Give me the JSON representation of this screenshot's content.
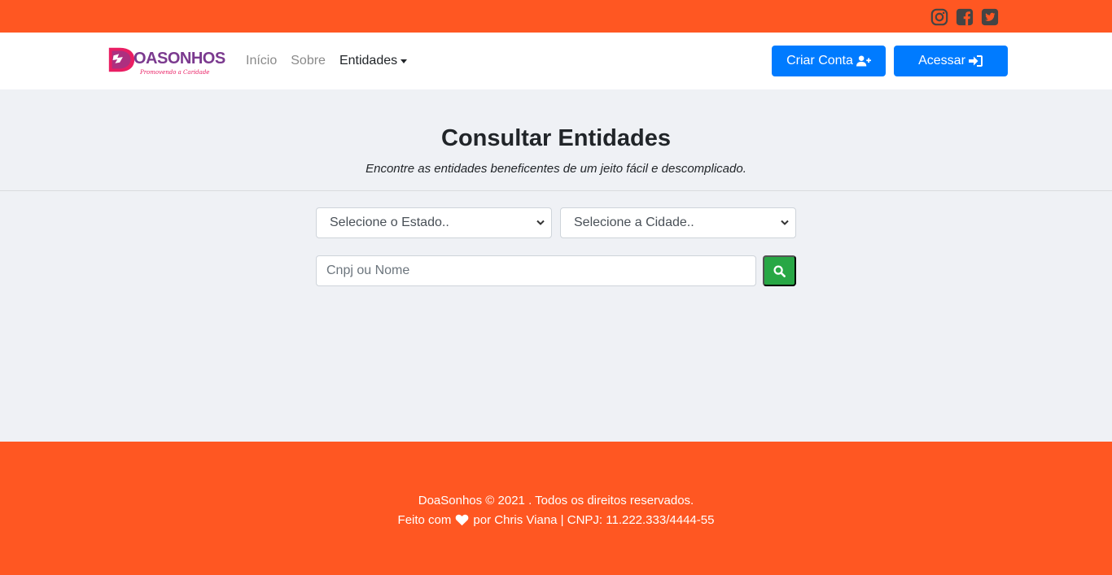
{
  "topbar": {
    "social": [
      {
        "icon": "instagram-icon"
      },
      {
        "icon": "facebook-icon"
      },
      {
        "icon": "twitter-icon"
      }
    ],
    "color": "#ff5722"
  },
  "navbar": {
    "brand_text": "OASONHOS",
    "brand_tagline": "Promovendo a Caridade",
    "links": [
      "Início",
      "Sobre",
      "Entidades"
    ],
    "create_account_label": "Criar Conta",
    "login_label": "Acessar",
    "button_color": "#007bff"
  },
  "hero": {
    "title": "Consultar Entidades",
    "subtitle": "Encontre as entidades beneficentes de um jeito fácil e descomplicado."
  },
  "filters": {
    "state_selected": "Selecione o Estado..",
    "city_selected": "Selecione a Cidade..",
    "search_placeholder": "Cnpj ou Nome",
    "search_button_icon": "search-icon",
    "search_button_color": "#28a745"
  },
  "footer": {
    "line1": "DoaSonhos © 2021 . Todos os direitos reservados.",
    "line2_prefix": "Feito com",
    "line2_suffix": "por Chris Viana | CNPJ: 11.222.333/4444-55",
    "icon": "heart-icon"
  }
}
